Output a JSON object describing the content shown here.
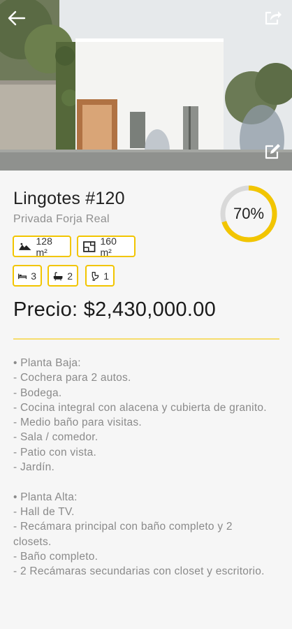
{
  "listing": {
    "title": "Lingotes #120",
    "subtitle": "Privada Forja Real",
    "progress_label": "70%",
    "progress_value": 0.7,
    "land_area": "128 m²",
    "built_area": "160 m²",
    "bedrooms": "3",
    "bathrooms": "2",
    "half_baths": "1",
    "price": "Precio: $2,430,000.00",
    "description": "• Planta Baja:\n- Cochera para 2 autos.\n- Bodega.\n- Cocina integral con alacena y cubierta de granito.\n- Medio baño para visitas.\n- Sala / comedor.\n- Patio con vista.\n- Jardín.\n\n• Planta Alta:\n- Hall de TV.\n- Recámara principal con baño completo y 2 closets.\n- Baño completo.\n- 2 Recámaras secundarias con closet y escritorio."
  },
  "icons": {
    "back": "arrow-left-icon",
    "share": "share-icon",
    "edit": "edit-icon",
    "land": "terrain-icon",
    "built": "floor-plan-icon",
    "bed": "bed-icon",
    "bath": "bathtub-icon",
    "toilet": "toilet-icon"
  },
  "colors": {
    "accent": "#f2c500",
    "progress_track": "#d9d9d9",
    "divider": "#f6dc6c"
  }
}
